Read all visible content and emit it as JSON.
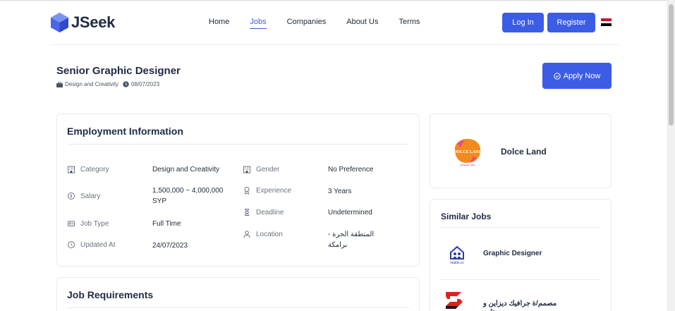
{
  "brand": {
    "name": "JSeek",
    "color": "#3b5ce5"
  },
  "nav": {
    "items": [
      {
        "label": "Home",
        "active": false
      },
      {
        "label": "Jobs",
        "active": true
      },
      {
        "label": "Companies",
        "active": false
      },
      {
        "label": "About Us",
        "active": false
      },
      {
        "label": "Terms",
        "active": false
      }
    ],
    "login_label": "Log In",
    "register_label": "Register",
    "language_flag": "egypt-flag-icon"
  },
  "job": {
    "title": "Senior Graphic Designer",
    "category": "Design and Creativity",
    "posted_date": "08/07/2023",
    "apply_label": "Apply Now"
  },
  "employment": {
    "title": "Employment Information",
    "left": [
      {
        "label": "Category",
        "value": "Design and Creativity",
        "icon": "building-icon"
      },
      {
        "label": "Salary",
        "value": "1,500,000 ~ 4,000,000 SYP",
        "icon": "coin-icon"
      },
      {
        "label": "Job Type",
        "value": "Full Time",
        "icon": "user-tie-icon"
      },
      {
        "label": "Updated At",
        "value": "24/07/2023",
        "icon": "clock-icon"
      }
    ],
    "right": [
      {
        "label": "Gender",
        "value": "No Preference",
        "icon": "building-icon"
      },
      {
        "label": "Experience",
        "value": "3 Years",
        "icon": "medal-icon"
      },
      {
        "label": "Deadline",
        "value": "Undetermined",
        "icon": "hourglass-icon"
      },
      {
        "label": "Location",
        "value": "المنطقة الحرة - برامكة",
        "icon": "user-icon"
      }
    ]
  },
  "requirements": {
    "title": "Job Requirements"
  },
  "company": {
    "name": "Dolce Land",
    "logo_text": "DOLCE LAND",
    "logo_subtext": "Handmade sweets"
  },
  "similar": {
    "title": "Similar Jobs",
    "jobs": [
      {
        "title": "Graphic Designer",
        "logo": "maids-logo",
        "logo_text": "maids.cc"
      },
      {
        "title": "مصمم/ة جرافيك ديزاين و موشن",
        "logo": "red-s-logo"
      }
    ]
  }
}
